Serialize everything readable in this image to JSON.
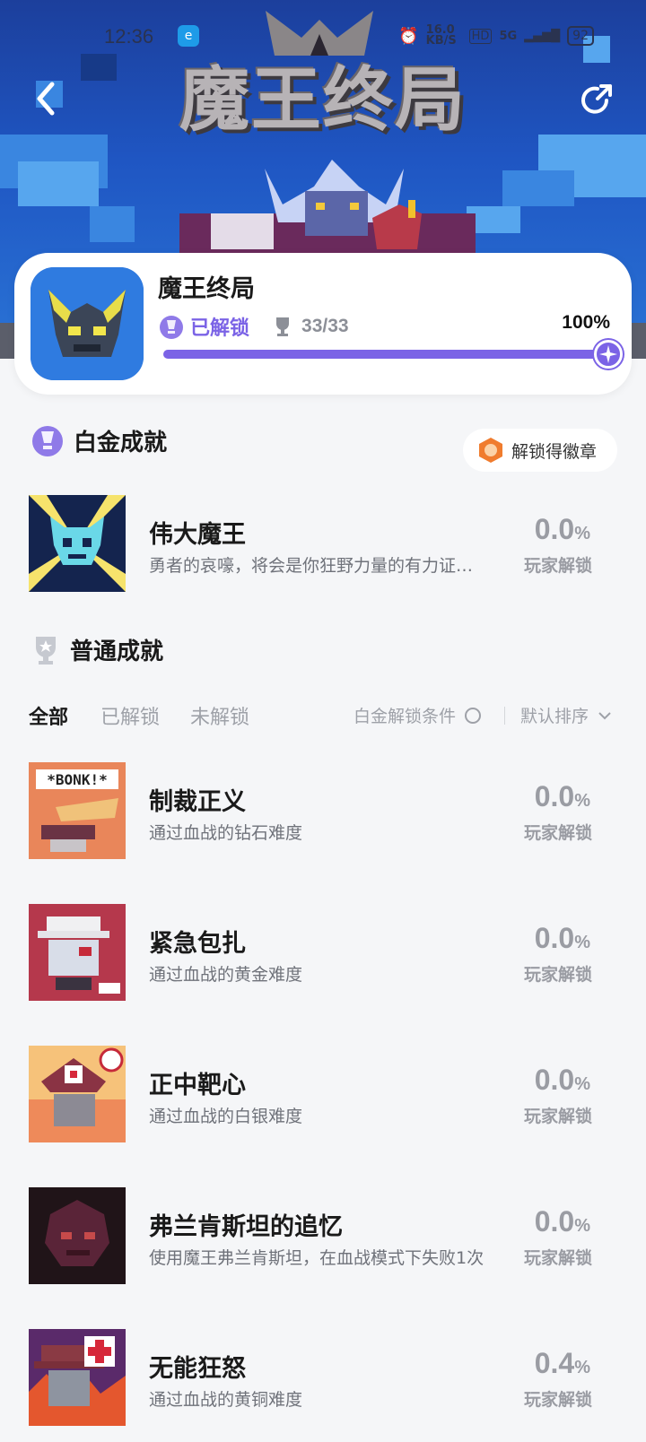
{
  "status_bar": {
    "time": "12:36",
    "network_speed": "16.0 KB/S",
    "hd": "HD",
    "signal": "5G",
    "battery": "92"
  },
  "header": {
    "banner_title": "魔王终局",
    "back_icon": "back-arrow-icon",
    "share_icon": "share-icon"
  },
  "game": {
    "name": "魔王终局",
    "status_label": "已解锁",
    "trophy_count": "33/33",
    "percent_label": "100%",
    "progress": 1.0,
    "accent_color": "#7b63e6"
  },
  "platinum_section": {
    "title": "白金成就",
    "badge_button_label": "解锁得徽章",
    "item": {
      "name": "伟大魔王",
      "desc": "勇者的哀嚎，将会是你狂野力量的有力证…",
      "percent": "0.0",
      "percent_sign": "%",
      "sub": "玩家解锁"
    }
  },
  "normal_section": {
    "title": "普通成就",
    "tabs": [
      "全部",
      "已解锁",
      "未解锁"
    ],
    "condition_label": "白金解锁条件",
    "sort_label": "默认排序"
  },
  "achievements": [
    {
      "name": "制裁正义",
      "desc": "通过血战的钻石难度",
      "percent": "0.0",
      "percent_sign": "%",
      "sub": "玩家解锁"
    },
    {
      "name": "紧急包扎",
      "desc": "通过血战的黄金难度",
      "percent": "0.0",
      "percent_sign": "%",
      "sub": "玩家解锁"
    },
    {
      "name": "正中靶心",
      "desc": "通过血战的白银难度",
      "percent": "0.0",
      "percent_sign": "%",
      "sub": "玩家解锁"
    },
    {
      "name": "弗兰肯斯坦的追忆",
      "desc": "使用魔王弗兰肯斯坦，在血战模式下失败1次",
      "percent": "0.0",
      "percent_sign": "%",
      "sub": "玩家解锁"
    },
    {
      "name": "无能狂怒",
      "desc": "通过血战的黄铜难度",
      "percent": "0.4",
      "percent_sign": "%",
      "sub": "玩家解锁"
    }
  ],
  "achievement_art": {
    "bonk_text": "*BONK!*"
  }
}
